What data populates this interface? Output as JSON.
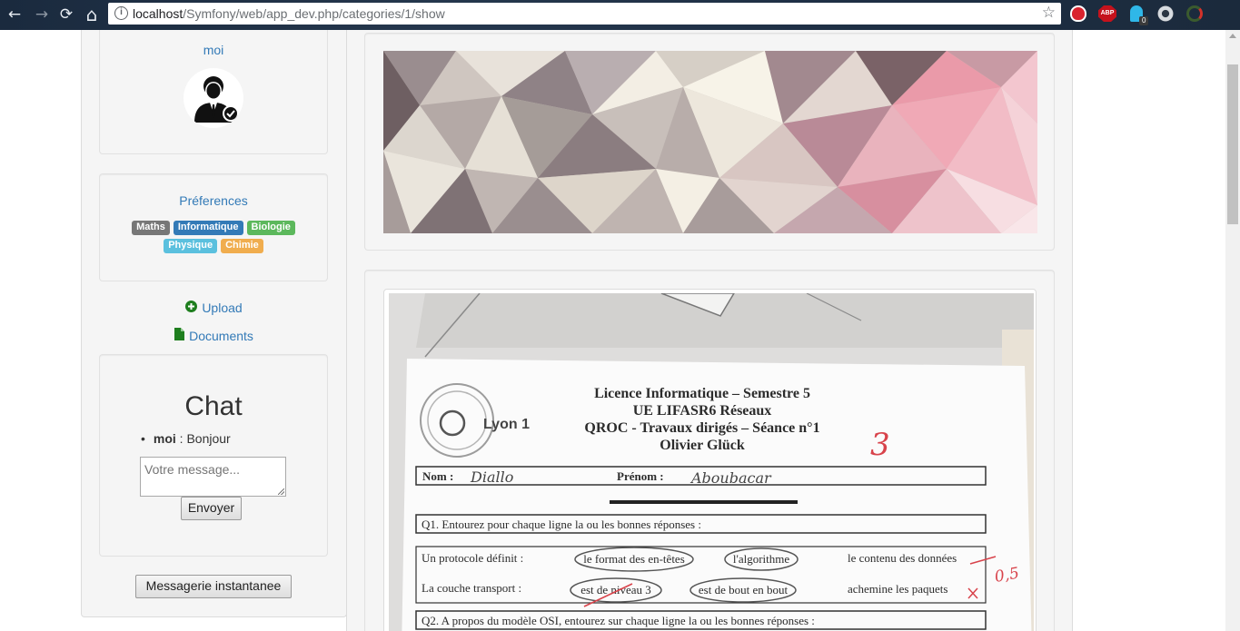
{
  "browser": {
    "url_host": "localhost",
    "url_path": "/Symfony/web/app_dev.php/categories/1/show",
    "nav": {
      "back_icon": "←",
      "forward_icon": "→",
      "reload_icon": "⟳",
      "home_icon": "⌂"
    },
    "extensions": {
      "abp_label": "ABP",
      "badge_count": "0"
    }
  },
  "profile": {
    "username": "moi"
  },
  "preferences": {
    "title": "Préferences",
    "tags_row1": [
      {
        "label": "Maths",
        "color": "#777777"
      },
      {
        "label": "Informatique",
        "color": "#337ab7"
      },
      {
        "label": "Biologie",
        "color": "#5cb85c"
      }
    ],
    "tags_row2": [
      {
        "label": "Physique",
        "color": "#5bc0de"
      },
      {
        "label": "Chimie",
        "color": "#f0ad4e"
      }
    ]
  },
  "actions": {
    "upload": "Upload",
    "documents": "Documents"
  },
  "chat": {
    "title": "Chat",
    "messages": [
      {
        "author": "moi",
        "text": " : Bonjour"
      }
    ],
    "input_placeholder": "Votre message...",
    "send_label": "Envoyer"
  },
  "messaging_button": "Messagerie instantanee",
  "document": {
    "logo_text": "Lyon 1",
    "heading_lines": [
      "Licence Informatique – Semestre 5",
      "UE LIFASR6 Réseaux",
      "QROC - Travaux dirigés – Séance n°1",
      "Olivier Glück"
    ],
    "grade_mark": "3",
    "nom_label": "Nom :",
    "nom_value": "Diallo",
    "prenom_label": "Prénom :",
    "prenom_value": "Aboubacar",
    "q1": "Q1. Entourez pour chaque ligne la ou les bonnes réponses :",
    "row1_label": "Un protocole définit :",
    "row1_options": [
      "le format des en-têtes",
      "l'algorithme",
      "le contenu des données"
    ],
    "row2_label": "La couche transport :",
    "row2_options": [
      "est de niveau 3",
      "est de bout en bout",
      "achemine les paquets"
    ],
    "side_mark": "0,5",
    "q2": "Q2. A propos du modèle OSI, entourez sur chaque ligne la ou les bonnes réponses :"
  }
}
